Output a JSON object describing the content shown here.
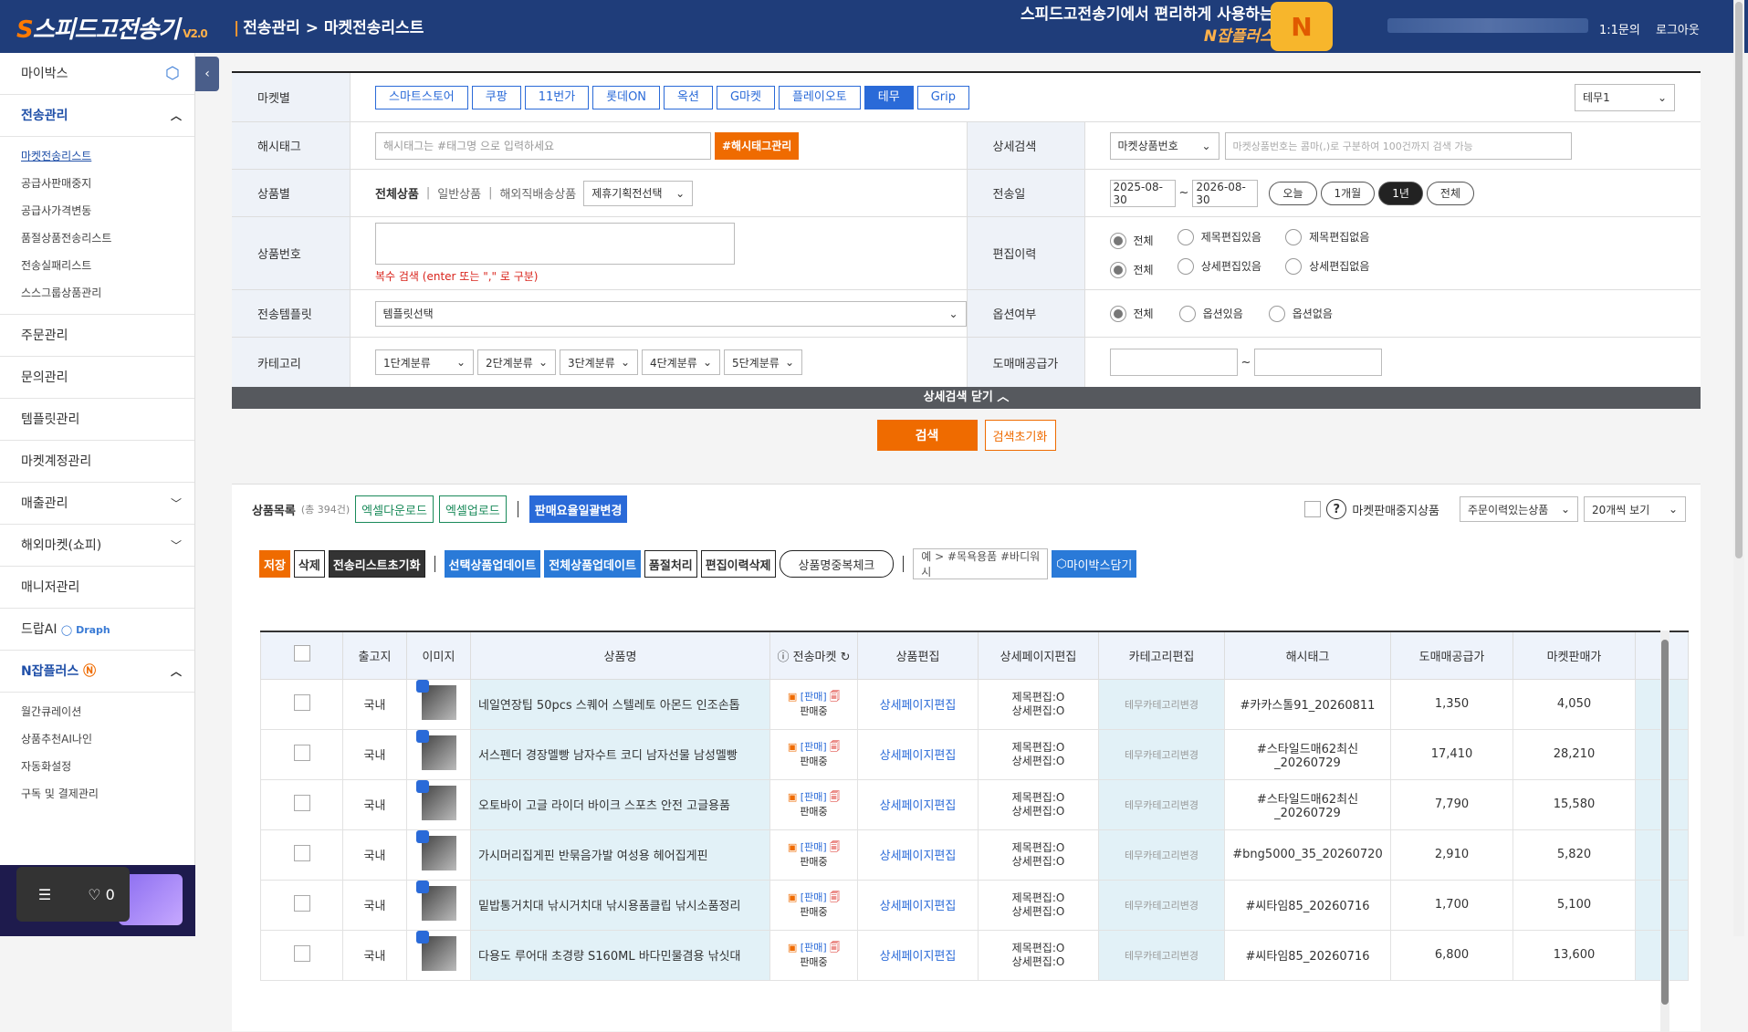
{
  "header": {
    "logo": "스피드고전송기",
    "version": "V2.0",
    "breadcrumb": "전송관리 > 마켓전송리스트",
    "promo_line1": "스피드고전송기에서 편리하게 사용하는",
    "promo_line2": "N잡플러스",
    "inquiry": "1:1문의",
    "logout": "로그아웃"
  },
  "sidebar": {
    "items": [
      {
        "label": "마이박스"
      },
      {
        "label": "전송관리"
      },
      {
        "label": "주문관리"
      },
      {
        "label": "문의관리"
      },
      {
        "label": "템플릿관리"
      },
      {
        "label": "마켓계정관리"
      },
      {
        "label": "매출관리"
      },
      {
        "label": "해외마켓(쇼피)"
      },
      {
        "label": "매니저관리"
      },
      {
        "label": "드랍AI"
      },
      {
        "label": "N잡플러스"
      }
    ],
    "draph": "Draph",
    "transfer_sub": [
      "마켓전송리스트",
      "공급사판매중지",
      "공급사가격변동",
      "품절상품전송리스트",
      "전송실패리스트",
      "스스그룹상품관리"
    ],
    "njob_sub": [
      "월간큐레이션",
      "상품추천AI나인",
      "자동화설정",
      "구독 및 결제관리"
    ],
    "float_like": "0"
  },
  "filter": {
    "market_label": "마켓별",
    "markets": [
      "스마트스토어",
      "쿠팡",
      "11번가",
      "롯데ON",
      "옥션",
      "G마켓",
      "플레이오토",
      "테무",
      "Grip"
    ],
    "account_select": "테무1",
    "hashtag_label": "해시태그",
    "hashtag_placeholder": "해시태그는 #태그명 으로 입력하세요",
    "hashtag_btn": "#해시태그관리",
    "detail_label": "상세검색",
    "detail_select": "마켓상품번호",
    "detail_placeholder": "마켓상품번호는 콤마(,)로 구분하여 100건까지 검색 가능",
    "product_type_label": "상품별",
    "product_types": [
      "전체상품",
      "일반상품",
      "해외직배송상품"
    ],
    "promo_select": "제휴기획전선택",
    "send_date_label": "전송일",
    "date_from": "2025-08-30",
    "date_to": "2026-08-30",
    "date_buttons": [
      "오늘",
      "1개월",
      "1년",
      "전체"
    ],
    "product_no_label": "상품번호",
    "product_no_hint": "복수 검색 (enter 또는 \",\" 로 구분)",
    "edit_history_label": "편집이력",
    "edit_row1": [
      "전체",
      "제목편집있음",
      "제목편집없음"
    ],
    "edit_row2": [
      "전체",
      "상세편집있음",
      "상세편집없음"
    ],
    "template_label": "전송템플릿",
    "template_select": "템플릿선택",
    "option_label": "옵션여부",
    "option_radios": [
      "전체",
      "옵션있음",
      "옵션없음"
    ],
    "category_label": "카테고리",
    "categories": [
      "1단계분류",
      "2단계분류",
      "3단계분류",
      "4단계분류",
      "5단계분류"
    ],
    "wholesale_label": "도매매공급가",
    "close_detail": "상세검색 닫기",
    "search_btn": "검색",
    "reset_btn": "검색초기화"
  },
  "list": {
    "title": "상품목록",
    "count": "(총 394건)",
    "excel_down": "엑셀다운로드",
    "excel_up": "엑셀업로드",
    "fee_change": "판매요율일괄변경",
    "stopped_label": "마켓판매중지상품",
    "order_select": "주문이력있는상품",
    "view_select": "20개씩 보기",
    "tools": [
      "저장",
      "삭제",
      "전송리스트초기화",
      "선택상품업데이트",
      "전체상품업데이트",
      "품절처리",
      "편집이력삭제",
      "상품명중복체크"
    ],
    "tag_example": "예 > #목욕용품 #바디워시",
    "mybox_btn": "마이박스담기",
    "columns": [
      "",
      "출고지",
      "이미지",
      "상품명",
      "전송마켓",
      "상품편집",
      "상세페이지편집",
      "카테고리편집",
      "해시태그",
      "도매매공급가",
      "마켓판매가"
    ],
    "sale_label": "[판매]",
    "selling": "판매중",
    "edit_link": "상세페이지편집",
    "cat_link": "테무카테고리변경",
    "title_edit": "제목편집:O",
    "detail_edit": "상세편집:O",
    "rows": [
      {
        "origin": "국내",
        "name": "네일연장팁 50pcs 스퀘어 스텔레토 아몬드 인조손톱",
        "tag": "#카카스톨91_20260811",
        "supply": "1,350",
        "price": "4,050"
      },
      {
        "origin": "국내",
        "name": "서스펜더 경장멜빵 남자수트 코디 남자선물 남성멜빵",
        "tag": "#스타일드매62최신_20260729",
        "supply": "17,410",
        "price": "28,210"
      },
      {
        "origin": "국내",
        "name": "오토바이 고글 라이더 바이크 스포츠 안전 고글용품",
        "tag": "#스타일드매62최신_20260729",
        "supply": "7,790",
        "price": "15,580"
      },
      {
        "origin": "국내",
        "name": "가시머리집게핀 반묶음가발 여성용 헤어집게핀",
        "tag": "#bng5000_35_20260720",
        "supply": "2,910",
        "price": "5,820"
      },
      {
        "origin": "국내",
        "name": "밑밥통거치대 낚시거치대 낚시용품클립 낚시소품정리",
        "tag": "#씨타임85_20260716",
        "supply": "1,700",
        "price": "5,100"
      },
      {
        "origin": "국내",
        "name": "다용도 루어대 초경량 S160ML 바다민물겸용 낚싯대",
        "tag": "#씨타임85_20260716",
        "supply": "6,800",
        "price": "13,600"
      }
    ]
  }
}
